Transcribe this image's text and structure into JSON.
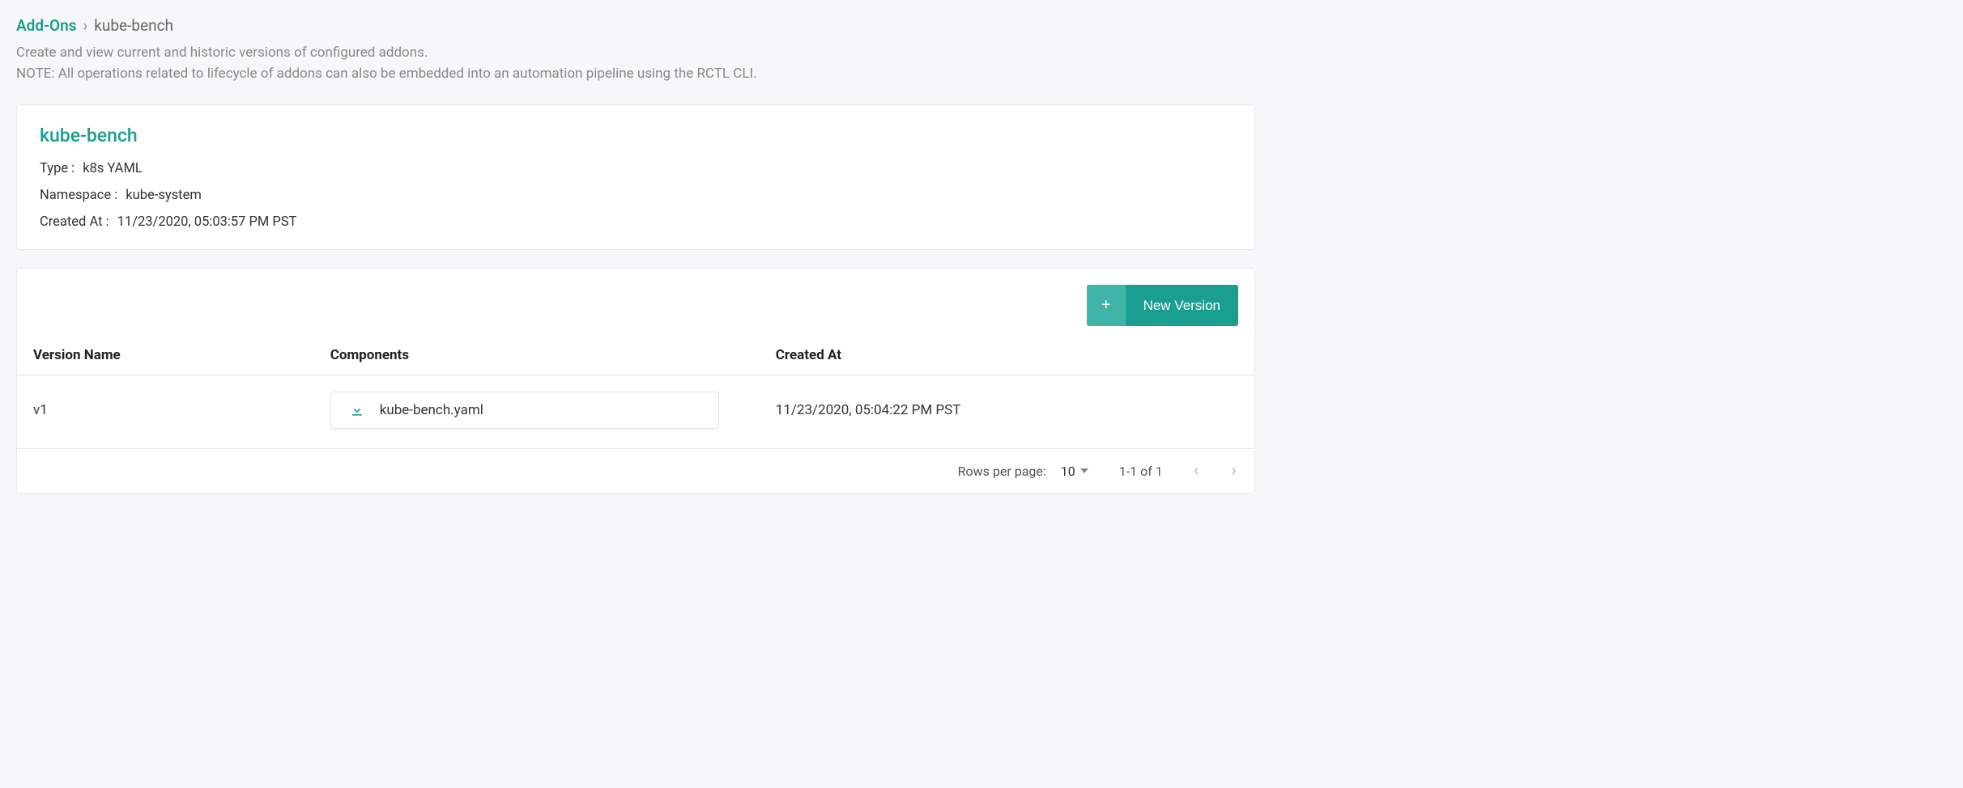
{
  "breadcrumb": {
    "root": "Add-Ons",
    "separator": "›",
    "current": "kube-bench"
  },
  "subtitle": "Create and view current and historic versions of configured addons.\nNOTE: All operations related to lifecycle of addons can also be embedded into an automation pipeline using the RCTL CLI.",
  "addon": {
    "name": "kube-bench",
    "type_label": "Type :",
    "type_value": "k8s YAML",
    "namespace_label": "Namespace :",
    "namespace_value": "kube-system",
    "created_label": "Created At :",
    "created_value": "11/23/2020, 05:03:57 PM PST"
  },
  "toolbar": {
    "new_version_label": "New Version",
    "plus": "+"
  },
  "table": {
    "columns": {
      "version_name": "Version Name",
      "components": "Components",
      "created_at": "Created At"
    },
    "rows": [
      {
        "version_name": "v1",
        "component_file": "kube-bench.yaml",
        "created_at": "11/23/2020, 05:04:22 PM PST"
      }
    ]
  },
  "pagination": {
    "rows_label": "Rows per page:",
    "rows_value": "10",
    "range": "1-1 of 1"
  }
}
